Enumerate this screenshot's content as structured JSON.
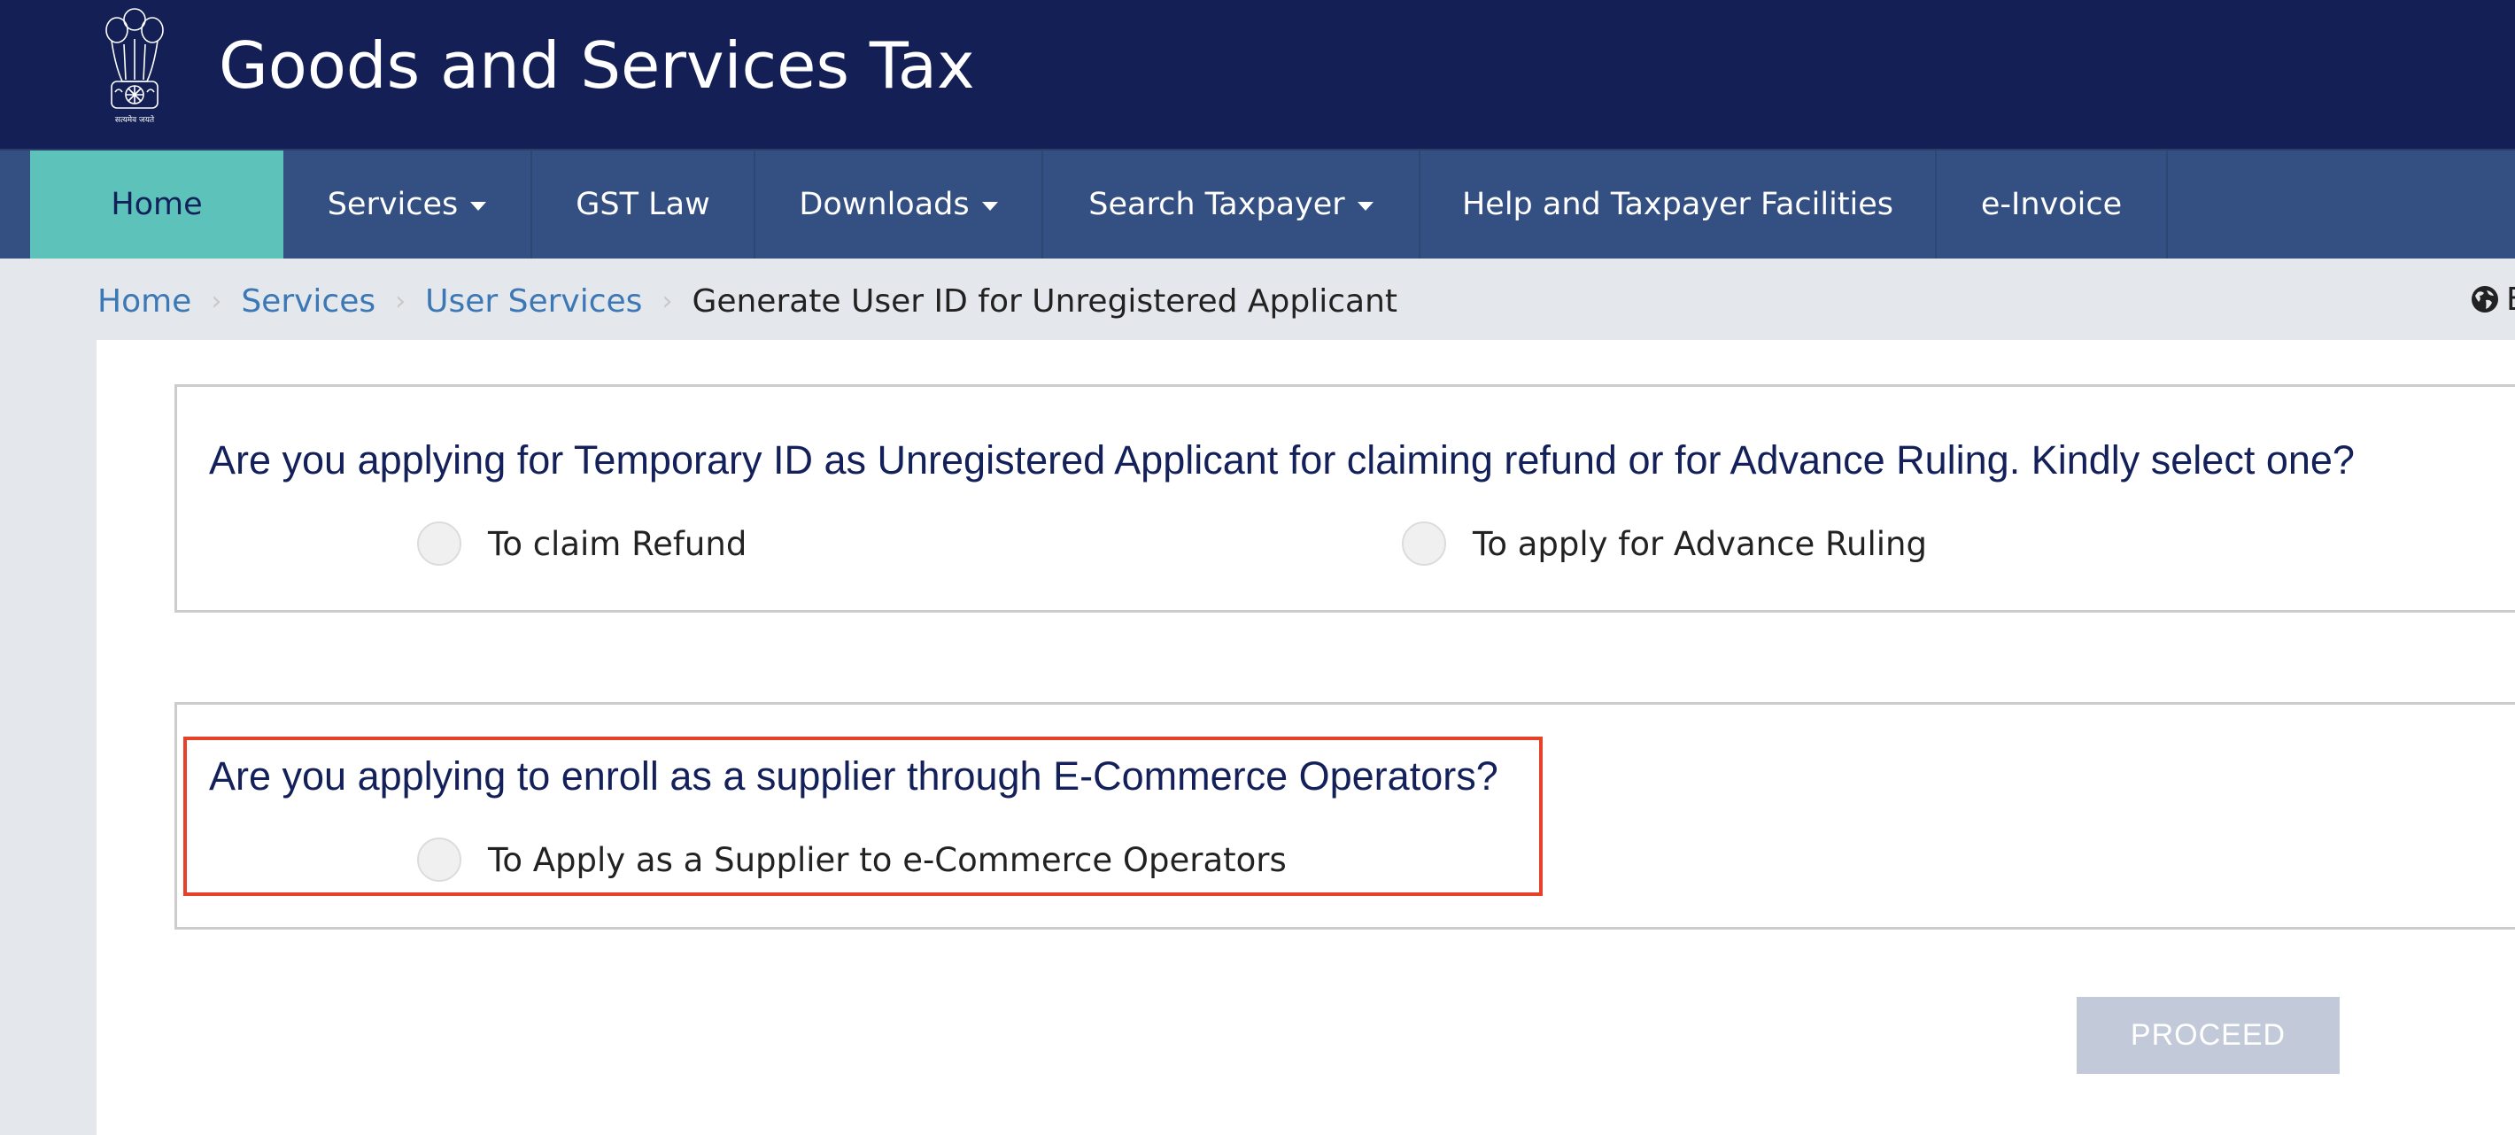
{
  "header": {
    "title": "Goods and Services Tax",
    "emblem_motto": "सत्यमेव जयते"
  },
  "nav": {
    "items": [
      {
        "label": "Home",
        "active": true,
        "dropdown": false
      },
      {
        "label": "Services",
        "active": false,
        "dropdown": true
      },
      {
        "label": "GST Law",
        "active": false,
        "dropdown": false
      },
      {
        "label": "Downloads",
        "active": false,
        "dropdown": true
      },
      {
        "label": "Search Taxpayer",
        "active": false,
        "dropdown": true
      },
      {
        "label": "Help and Taxpayer Facilities",
        "active": false,
        "dropdown": false
      },
      {
        "label": "e-Invoice",
        "active": false,
        "dropdown": false
      }
    ]
  },
  "breadcrumb": {
    "items": [
      "Home",
      "Services",
      "User Services"
    ],
    "current": "Generate User ID for Unregistered Applicant",
    "separator": "›"
  },
  "language": {
    "icon": "globe-icon",
    "label_visible": "E"
  },
  "questions": [
    {
      "text": "Are you applying for Temporary ID as Unregistered Applicant for claiming refund or for Advance Ruling. Kindly select one?",
      "options": [
        {
          "label": "To claim Refund",
          "selected": false
        },
        {
          "label": "To apply for Advance Ruling",
          "selected": false
        }
      ]
    },
    {
      "text": "Are you applying to enroll as a supplier through E-Commerce Operators?",
      "highlighted": true,
      "options": [
        {
          "label": "To Apply as a Supplier to e-Commerce Operators",
          "selected": false
        }
      ]
    }
  ],
  "actions": {
    "proceed_label": "PROCEED",
    "proceed_enabled": false
  },
  "colors": {
    "header_bg": "#131f55",
    "nav_bg": "#344f82",
    "nav_active": "#5cc2ba",
    "question_text": "#13205a",
    "link": "#3c78b5",
    "highlight_border": "#e8412a",
    "button_disabled": "#c2c9d9"
  }
}
